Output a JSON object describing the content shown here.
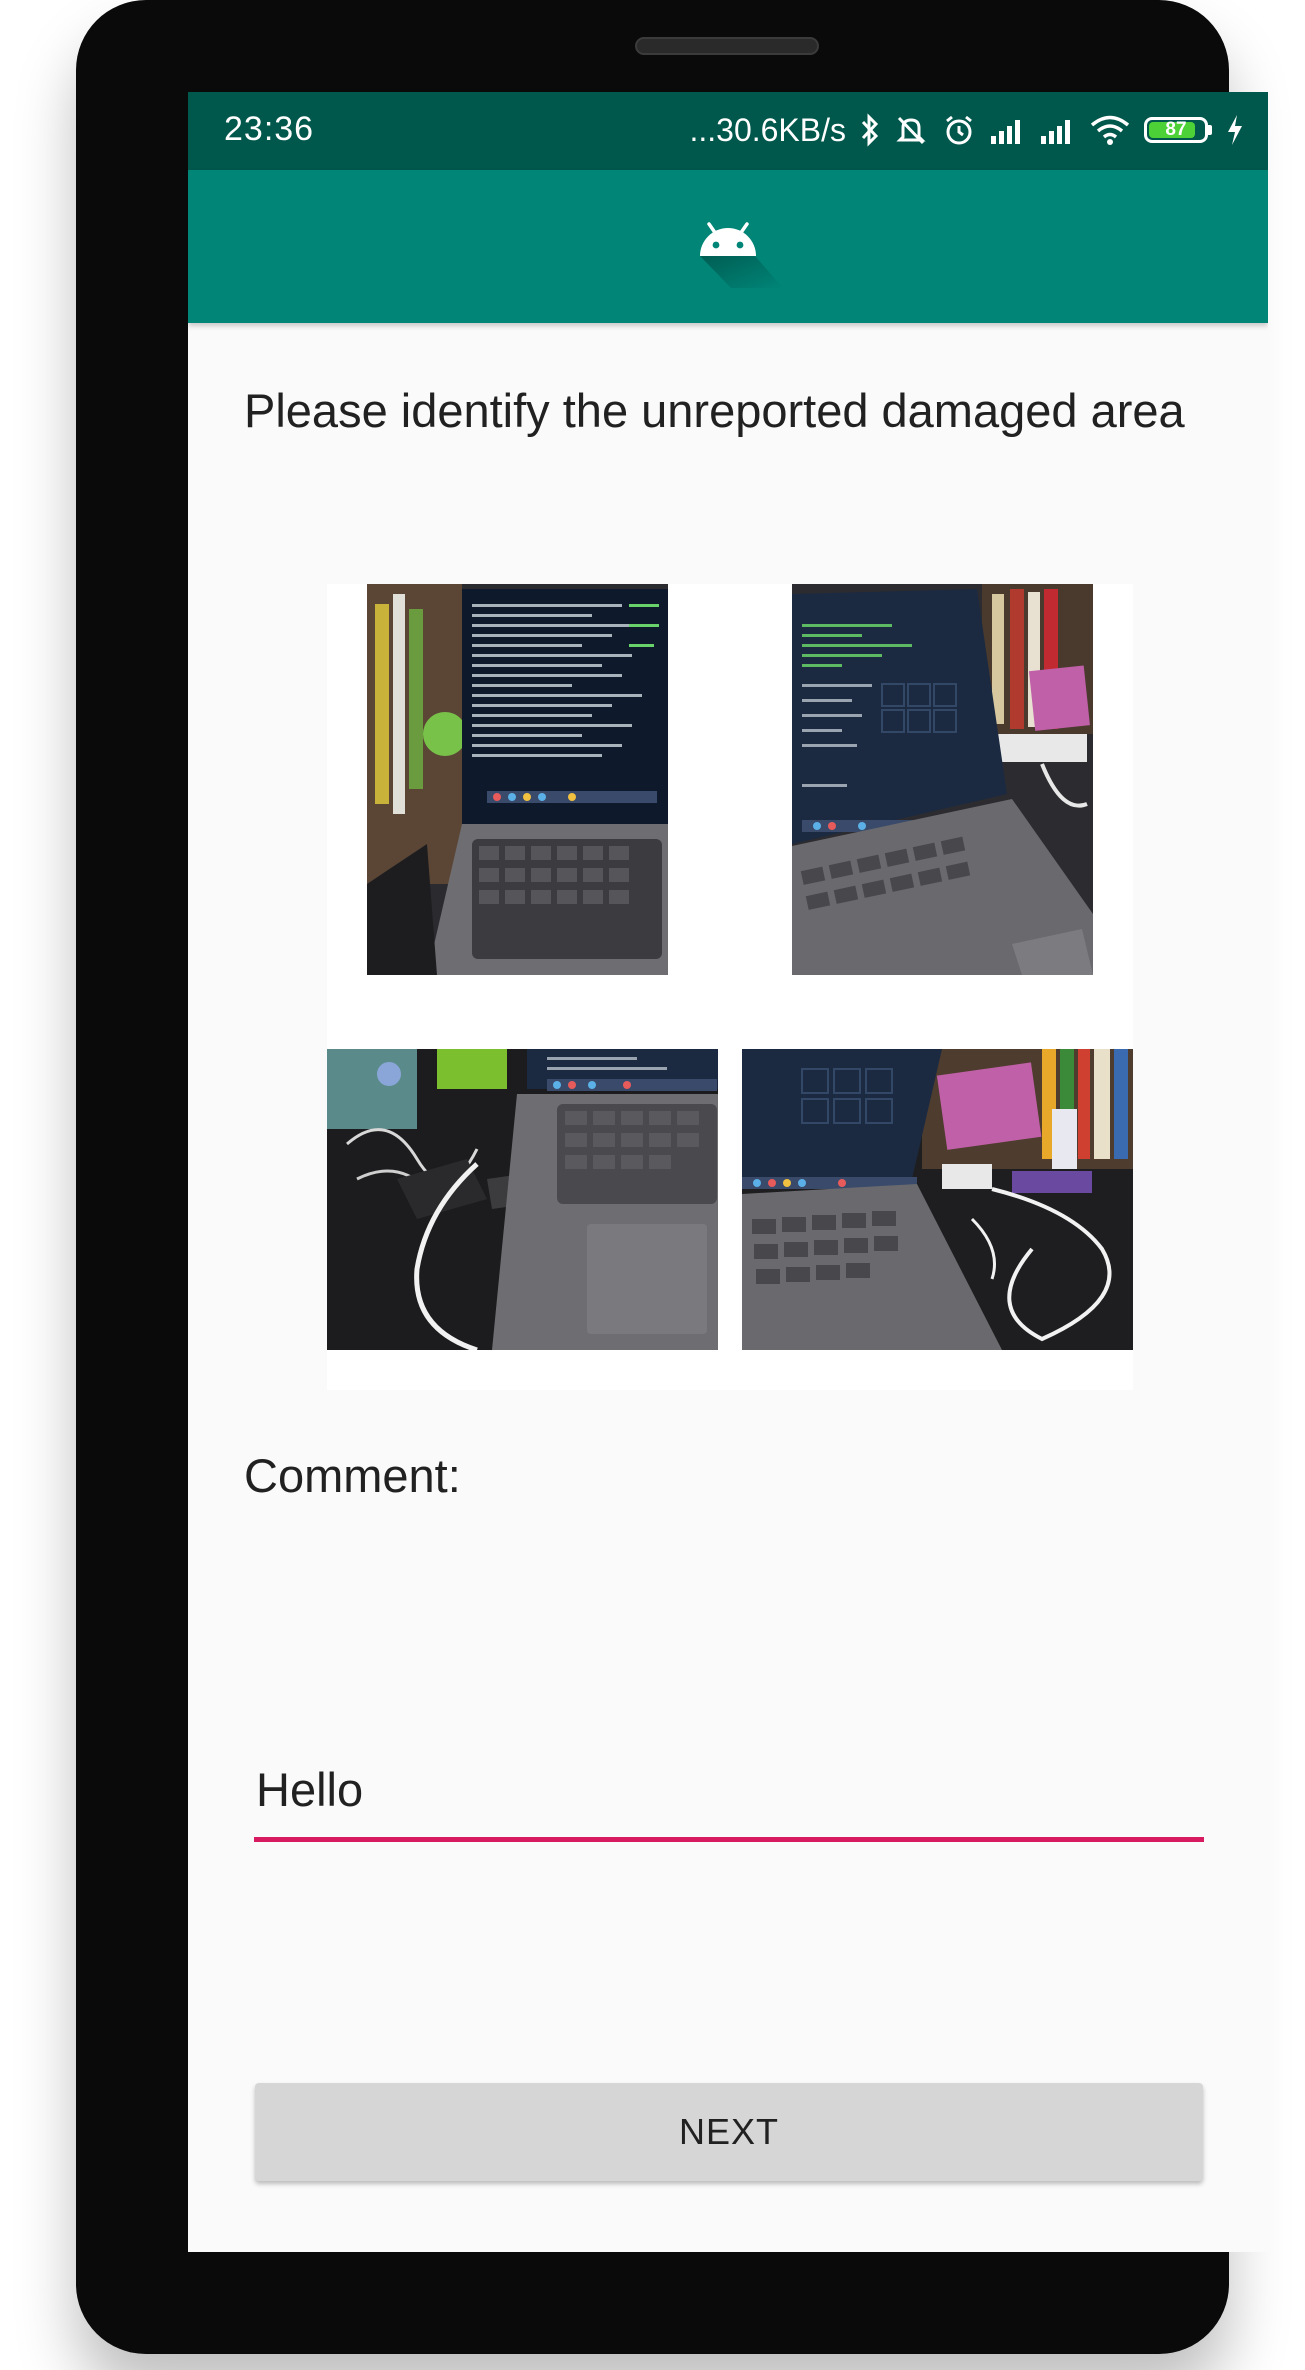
{
  "status_bar": {
    "time": "23:36",
    "network_speed": "...30.6KB/s",
    "battery_level": "87",
    "battery_fraction": 0.87,
    "icons": [
      "bluetooth-icon",
      "mute-icon",
      "alarm-icon",
      "signal-icon",
      "signal-icon",
      "wifi-icon",
      "battery-icon",
      "charging-icon"
    ]
  },
  "app_bar": {
    "logo_icon": "android-icon",
    "background_color": "#008577",
    "status_color": "#00574b"
  },
  "main": {
    "prompt": "Please identify the unreported damaged area",
    "photos": [
      {
        "icon": "laptop-photo-1"
      },
      {
        "icon": "laptop-photo-2"
      },
      {
        "icon": "laptop-photo-3"
      },
      {
        "icon": "laptop-photo-4"
      }
    ],
    "comment_label": "Comment:",
    "comment_value": "Hello",
    "next_label": "NEXT",
    "accent_color": "#d81b60"
  }
}
